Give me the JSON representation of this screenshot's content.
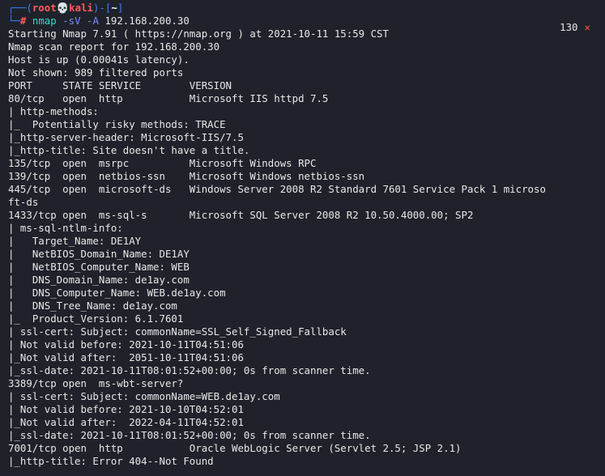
{
  "prompt": {
    "user": "root",
    "skull": "💀",
    "host": "kali",
    "dir": "~",
    "symbol": "#",
    "command": "nmap",
    "flags": "-sV -A",
    "target": "192.168.200.30"
  },
  "status": {
    "code": "130",
    "icon": "✕"
  },
  "output": [
    "Starting Nmap 7.91 ( https://nmap.org ) at 2021-10-11 15:59 CST",
    "Nmap scan report for 192.168.200.30",
    "Host is up (0.00041s latency).",
    "Not shown: 989 filtered ports",
    "PORT     STATE SERVICE        VERSION",
    "80/tcp   open  http           Microsoft IIS httpd 7.5",
    "| http-methods:",
    "|_  Potentially risky methods: TRACE",
    "|_http-server-header: Microsoft-IIS/7.5",
    "|_http-title: Site doesn't have a title.",
    "135/tcp  open  msrpc          Microsoft Windows RPC",
    "139/tcp  open  netbios-ssn    Microsoft Windows netbios-ssn",
    "445/tcp  open  microsoft-ds   Windows Server 2008 R2 Standard 7601 Service Pack 1 microso",
    "ft-ds",
    "1433/tcp open  ms-sql-s       Microsoft SQL Server 2008 R2 10.50.4000.00; SP2",
    "| ms-sql-ntlm-info:",
    "|   Target_Name: DE1AY",
    "|   NetBIOS_Domain_Name: DE1AY",
    "|   NetBIOS_Computer_Name: WEB",
    "|   DNS_Domain_Name: de1ay.com",
    "|   DNS_Computer_Name: WEB.de1ay.com",
    "|   DNS_Tree_Name: de1ay.com",
    "|_  Product_Version: 6.1.7601",
    "| ssl-cert: Subject: commonName=SSL_Self_Signed_Fallback",
    "| Not valid before: 2021-10-11T04:51:06",
    "|_Not valid after:  2051-10-11T04:51:06",
    "|_ssl-date: 2021-10-11T08:01:52+00:00; 0s from scanner time.",
    "3389/tcp open  ms-wbt-server?",
    "| ssl-cert: Subject: commonName=WEB.de1ay.com",
    "| Not valid before: 2021-10-10T04:52:01",
    "|_Not valid after:  2022-04-11T04:52:01",
    "|_ssl-date: 2021-10-11T08:01:52+00:00; 0s from scanner time.",
    "7001/tcp open  http           Oracle WebLogic Server (Servlet 2.5; JSP 2.1)",
    "|_http-title: Error 404--Not Found"
  ],
  "colors": {
    "background": "#1f222a",
    "text": "#e8e8e8",
    "prompt_frame": "#3b7cff",
    "prompt_user": "#ff5b5b",
    "command": "#38d7c9",
    "flags": "#7d8cff",
    "error": "#ff4f4f"
  }
}
